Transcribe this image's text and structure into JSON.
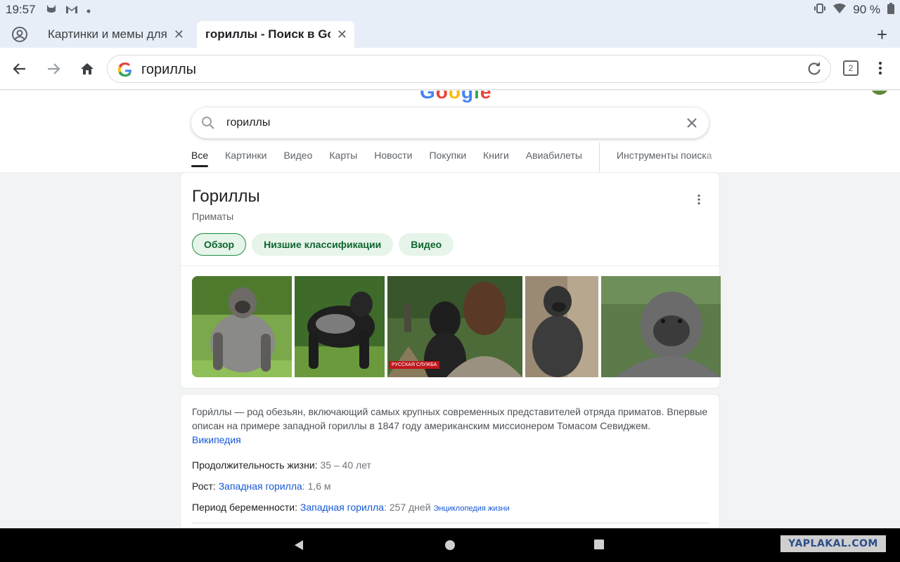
{
  "status_bar": {
    "time": "19:57",
    "battery": "90 %"
  },
  "tabs": [
    {
      "title": "Картинки и мемы для",
      "active": false
    },
    {
      "title": "гориллы - Поиск в Google",
      "active": true
    }
  ],
  "toolbar": {
    "url": "гориллы",
    "tab_count": "2"
  },
  "search": {
    "logo": "Google",
    "query": "гориллы",
    "nav": [
      "Все",
      "Картинки",
      "Видео",
      "Карты",
      "Новости",
      "Покупки",
      "Книги",
      "Авиабилеты"
    ],
    "tools": "Инструменты поиска"
  },
  "knowledge_panel": {
    "title": "Гориллы",
    "subtitle": "Приматы",
    "chips": [
      "Обзор",
      "Низшие классификации",
      "Видео"
    ],
    "image_badge": "РУССКАЯ СЛУЖБА",
    "description": "Гори́ллы — род обезьян, включающий самых крупных современных представителей отряда приматов. Впервые описан на примере западной гориллы в 1847 году американским миссионером Томасом Севиджем.",
    "source_link": "Википедия",
    "facts": [
      {
        "label": "Продолжительность жизни:",
        "link": "",
        "value": "35 – 40 лет",
        "source": ""
      },
      {
        "label": "Рост:",
        "link": "Западная горилла",
        "value": ": 1,6 м",
        "source": ""
      },
      {
        "label": "Период беременности:",
        "link": "Западная горилла",
        "value": ": 257 дней",
        "source": "Энциклопедия жизни"
      }
    ]
  },
  "watermark": "YAPLAKAL.COM",
  "colors": {
    "accent": "#1558d6",
    "chip_bg": "#e6f4ea",
    "chip_text": "#0d652d"
  }
}
